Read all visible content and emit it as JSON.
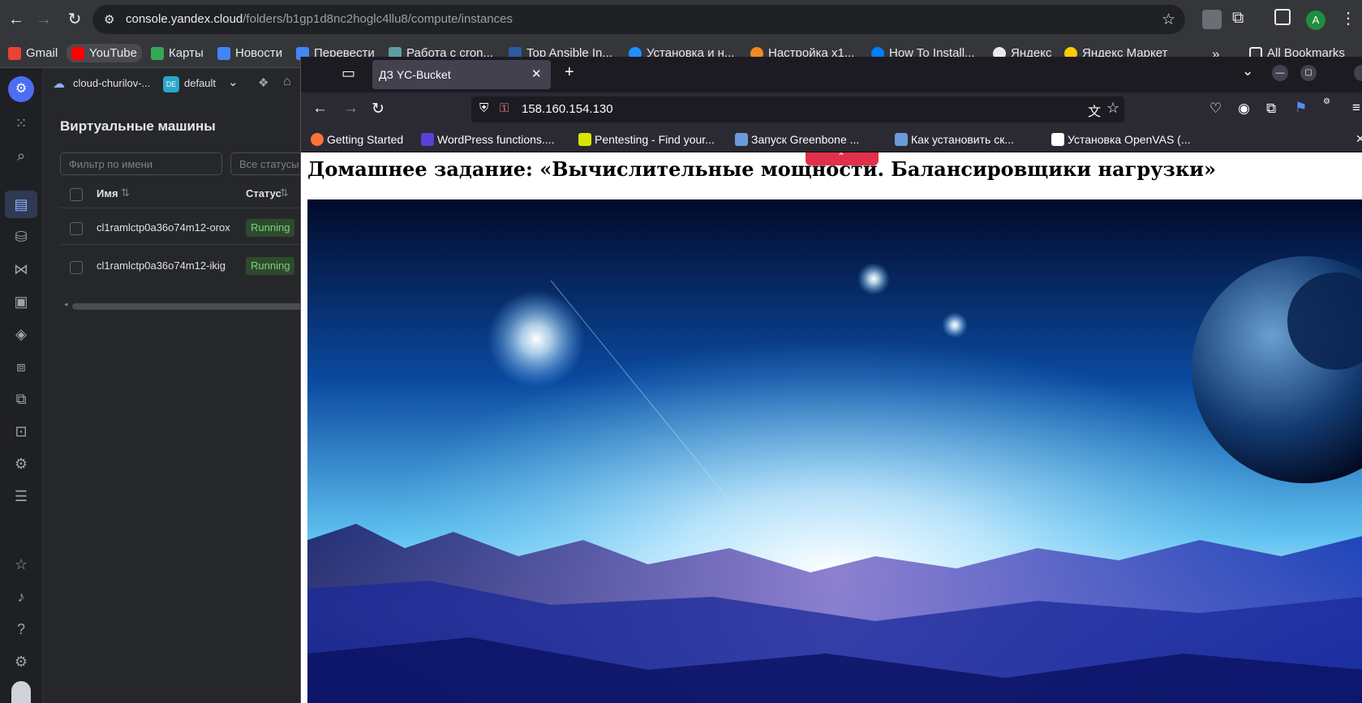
{
  "chrome": {
    "url_host": "console.yandex.cloud",
    "url_path": "/folders/b1gp1d8nc2hoglc4llu8/compute/instances",
    "profile_initial": "A",
    "bookmarks": [
      {
        "label": "Gmail",
        "icon": "gmail-icon",
        "color": "#ea4335"
      },
      {
        "label": "YouTube",
        "icon": "youtube-icon",
        "color": "#ff0000"
      },
      {
        "label": "Карты",
        "icon": "maps-icon",
        "color": "#34a853"
      },
      {
        "label": "Новости",
        "icon": "news-icon",
        "color": "#4285f4"
      },
      {
        "label": "Перевести",
        "icon": "translate-icon",
        "color": "#4285f4"
      },
      {
        "label": "Работа с cron...",
        "icon": "cron-icon",
        "color": "#5f9ea0"
      },
      {
        "label": "Top Ansible In...",
        "icon": "ansible-icon",
        "color": "#2c5aa0"
      },
      {
        "label": "Установка и н...",
        "icon": "setup-icon",
        "color": "#1e90ff"
      },
      {
        "label": "Настройка x1...",
        "icon": "settings-site-icon",
        "color": "#f08a24"
      },
      {
        "label": "How To Install...",
        "icon": "digitalocean-icon",
        "color": "#0080ff"
      },
      {
        "label": "Яндекс",
        "icon": "globe-icon",
        "color": "#e8eaed"
      },
      {
        "label": "Яндекс Маркет",
        "icon": "market-icon",
        "color": "#ffcc00"
      }
    ],
    "all_bookmarks_label": "All Bookmarks"
  },
  "yc": {
    "cloud_name": "cloud-churilov-...",
    "folder_badge": "DE",
    "folder_name": "default",
    "title": "Виртуальные машины",
    "filter_placeholder": "Фильтр по имени",
    "status_filter": "Все статусы",
    "columns": {
      "name": "Имя",
      "status": "Статус"
    },
    "rows": [
      {
        "name": "cl1ramlctp0a36o74m12-orox",
        "status": "Running"
      },
      {
        "name": "cl1ramlctp0a36o74m12-ikig",
        "status": "Running"
      }
    ]
  },
  "firefox": {
    "tab_title": "ДЗ YC-Bucket",
    "url": "158.160.154.130",
    "bookmarks": [
      {
        "label": "Getting Started",
        "icon": "firefox-icon",
        "color": "#ff7139"
      },
      {
        "label": "WordPress functions....",
        "icon": "kinsta-icon",
        "color": "#5b3fd8"
      },
      {
        "label": "Pentesting - Find your...",
        "icon": "pentest-icon",
        "color": "#d7e600"
      },
      {
        "label": "Запуск Greenbone ...",
        "icon": "greenbone-icon",
        "color": "#6a9bd8"
      },
      {
        "label": "Как установить ск...",
        "icon": "search-doc-icon",
        "color": "#6a9bd8"
      },
      {
        "label": "Установка OpenVAS (...",
        "icon": "g-icon",
        "color": "#ffffff"
      }
    ]
  },
  "page": {
    "heading": "Домашнее задание: «Вычислительные мощности. Балансировщики нагрузки»"
  }
}
